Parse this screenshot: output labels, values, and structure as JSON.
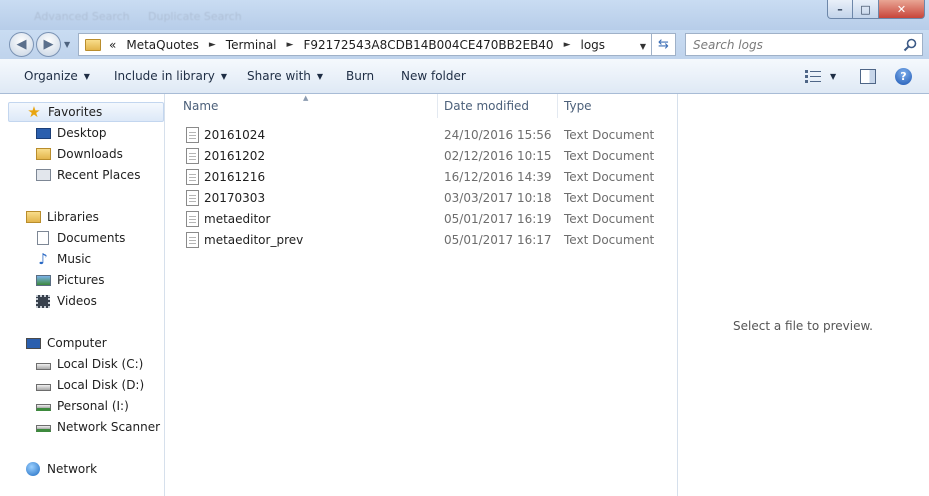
{
  "window": {
    "ghost_tabs": [
      "Advanced Search",
      "Duplicate Search"
    ],
    "controls": {
      "minimize": "–",
      "maximize": "□",
      "close": "✕"
    }
  },
  "address": {
    "overflow": "«",
    "crumbs": [
      "MetaQuotes",
      "Terminal",
      "F92172543A8CDB14B004CE470BB2EB40",
      "logs"
    ],
    "separator": "►",
    "search_placeholder": "Search logs"
  },
  "toolbar": {
    "organize": "Organize",
    "include_in_library": "Include in library",
    "share_with": "Share with",
    "burn": "Burn",
    "new_folder": "New folder"
  },
  "nav": {
    "favorites": {
      "label": "Favorites",
      "items": [
        "Desktop",
        "Downloads",
        "Recent Places"
      ]
    },
    "libraries": {
      "label": "Libraries",
      "items": [
        "Documents",
        "Music",
        "Pictures",
        "Videos"
      ]
    },
    "computer": {
      "label": "Computer",
      "items": [
        "Local Disk (C:)",
        "Local Disk (D:)",
        "Personal (I:)",
        "Network Scanner (Z:"
      ]
    },
    "network": {
      "label": "Network"
    }
  },
  "columns": {
    "name": "Name",
    "date": "Date modified",
    "type": "Type"
  },
  "files": [
    {
      "name": "20161024",
      "date": "24/10/2016 15:56",
      "type": "Text Document"
    },
    {
      "name": "20161202",
      "date": "02/12/2016 10:15",
      "type": "Text Document"
    },
    {
      "name": "20161216",
      "date": "16/12/2016 14:39",
      "type": "Text Document"
    },
    {
      "name": "20170303",
      "date": "03/03/2017 10:18",
      "type": "Text Document"
    },
    {
      "name": "metaeditor",
      "date": "05/01/2017 16:19",
      "type": "Text Document"
    },
    {
      "name": "metaeditor_prev",
      "date": "05/01/2017 16:17",
      "type": "Text Document"
    }
  ],
  "preview": {
    "message": "Select a file to preview."
  },
  "icons": {
    "favorites": "star-icon",
    "desktop": "desktop-icon",
    "downloads": "downloads-folder-icon",
    "recent": "recent-places-icon",
    "libraries": "libraries-icon",
    "documents": "documents-icon",
    "music": "music-note-icon",
    "pictures": "pictures-icon",
    "videos": "film-icon",
    "computer": "computer-icon",
    "disk": "hard-disk-icon",
    "network_drive": "network-drive-icon",
    "network": "network-icon",
    "file": "text-file-icon"
  },
  "colors": {
    "accent": "#3d6fb6",
    "frame": "#c9dcf2",
    "selection": "#dde9f8"
  }
}
